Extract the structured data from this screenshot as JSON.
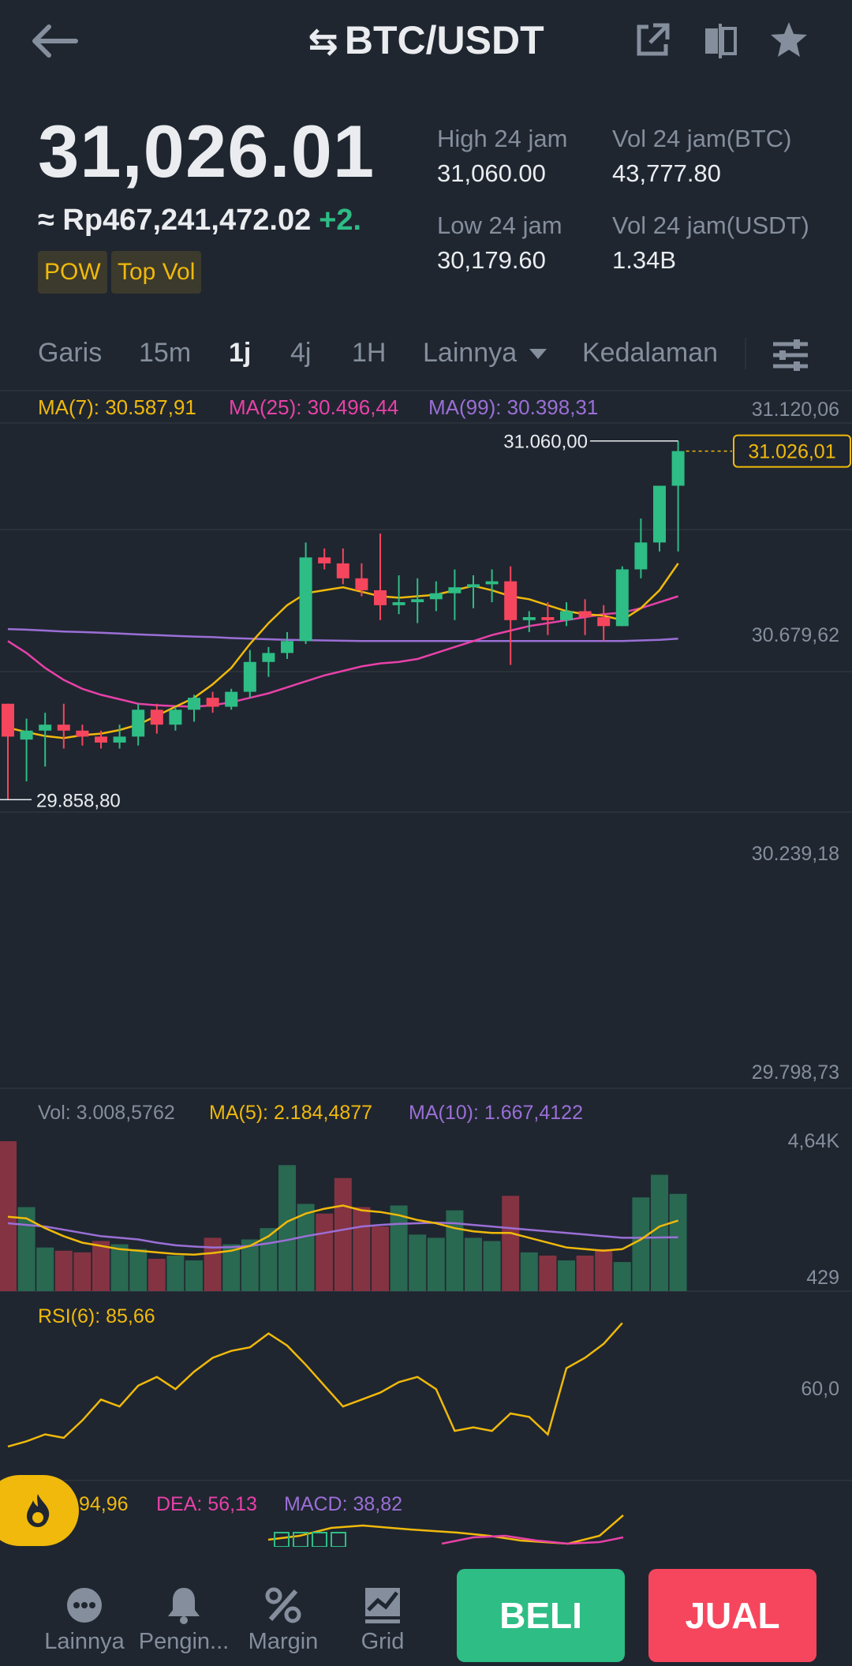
{
  "header": {
    "pair": "BTC/USDT",
    "swap_symbol": "⇆"
  },
  "price": {
    "last": "31,026.01",
    "fiat": "≈ Rp467,241,472.02",
    "change": "+2."
  },
  "tags": [
    "POW",
    "Top Vol"
  ],
  "stats": {
    "high_label": "High 24 jam",
    "high_value": "31,060.00",
    "low_label": "Low 24 jam",
    "low_value": "30,179.60",
    "vol_btc_label": "Vol 24 jam(BTC)",
    "vol_btc_value": "43,777.80",
    "vol_usdt_label": "Vol 24 jam(USDT)",
    "vol_usdt_value": "1.34B"
  },
  "timeframes": {
    "items": [
      "Garis",
      "15m",
      "1j",
      "4j",
      "1H",
      "Lainnya",
      "Kedalaman"
    ],
    "active": "1j"
  },
  "colors": {
    "up": "#2ebd85",
    "down": "#f6465d",
    "ma7": "#f0b90b",
    "ma25": "#e841a8",
    "ma99": "#9b6fd6",
    "accent": "#f0b90b"
  },
  "chart_data": [
    {
      "type": "candlestick",
      "title": "",
      "legend": {
        "ma7": "MA(7): 30.587,91",
        "ma25": "MA(25): 30.496,44",
        "ma99": "MA(99): 30.398,31"
      },
      "y_ticks": [
        "31.120,06",
        "30.679,62",
        "30.239,18",
        "29.798,73"
      ],
      "ylim": [
        29798.73,
        31120.06
      ],
      "max_label": "31.060,00",
      "min_label": "29.858,80",
      "last_price_label": "31.026,01",
      "candles": [
        [
          30180,
          30180,
          29860,
          30070
        ],
        [
          30060,
          30130,
          29920,
          30090
        ],
        [
          30090,
          30150,
          29970,
          30110
        ],
        [
          30110,
          30180,
          30030,
          30090
        ],
        [
          30090,
          30110,
          30040,
          30070
        ],
        [
          30070,
          30090,
          30030,
          30050
        ],
        [
          30050,
          30110,
          30030,
          30070
        ],
        [
          30070,
          30180,
          30040,
          30160
        ],
        [
          30160,
          30180,
          30080,
          30110
        ],
        [
          30110,
          30170,
          30090,
          30160
        ],
        [
          30160,
          30210,
          30120,
          30200
        ],
        [
          30200,
          30220,
          30150,
          30170
        ],
        [
          30170,
          30230,
          30160,
          30220
        ],
        [
          30220,
          30360,
          30200,
          30320
        ],
        [
          30320,
          30370,
          30270,
          30350
        ],
        [
          30350,
          30420,
          30330,
          30390
        ],
        [
          30390,
          30720,
          30380,
          30670
        ],
        [
          30670,
          30700,
          30630,
          30650
        ],
        [
          30650,
          30700,
          30580,
          30600
        ],
        [
          30600,
          30650,
          30540,
          30560
        ],
        [
          30560,
          30750,
          30460,
          30510
        ],
        [
          30510,
          30610,
          30480,
          30520
        ],
        [
          30520,
          30600,
          30450,
          30530
        ],
        [
          30530,
          30590,
          30490,
          30550
        ],
        [
          30550,
          30630,
          30460,
          30570
        ],
        [
          30570,
          30610,
          30500,
          30580
        ],
        [
          30580,
          30630,
          30520,
          30590
        ],
        [
          30590,
          30640,
          30310,
          30460
        ],
        [
          30460,
          30490,
          30420,
          30470
        ],
        [
          30470,
          30520,
          30410,
          30460
        ],
        [
          30460,
          30520,
          30440,
          30490
        ],
        [
          30490,
          30530,
          30410,
          30470
        ],
        [
          30470,
          30510,
          30390,
          30440
        ],
        [
          30440,
          30640,
          30440,
          30630
        ],
        [
          30630,
          30800,
          30600,
          30720
        ],
        [
          30720,
          30900,
          30690,
          30910
        ],
        [
          30910,
          31060,
          30690,
          31026
        ]
      ],
      "ma7": [
        30100,
        30085,
        30072,
        30065,
        30075,
        30080,
        30092,
        30110,
        30140,
        30170,
        30200,
        30245,
        30300,
        30380,
        30450,
        30510,
        30550,
        30560,
        30570,
        30555,
        30540,
        30535,
        30540,
        30545,
        30560,
        30575,
        30560,
        30540,
        30530,
        30510,
        30490,
        30480,
        30475,
        30460,
        30500,
        30560,
        30650
      ],
      "ma25": [
        30390,
        30350,
        30300,
        30260,
        30230,
        30210,
        30195,
        30180,
        30175,
        30172,
        30170,
        30175,
        30185,
        30200,
        30215,
        30235,
        30255,
        30275,
        30290,
        30305,
        30315,
        30320,
        30330,
        30350,
        30370,
        30390,
        30410,
        30425,
        30440,
        30450,
        30460,
        30470,
        30480,
        30485,
        30500,
        30520,
        30540
      ],
      "ma99": [
        30430,
        30428,
        30425,
        30422,
        30420,
        30418,
        30415,
        30412,
        30410,
        30407,
        30405,
        30403,
        30400,
        30398,
        30396,
        30394,
        30393,
        30392,
        30391,
        30390,
        30390,
        30390,
        30390,
        30390,
        30390,
        30390,
        30390,
        30390,
        30390,
        30390,
        30390,
        30390,
        30390,
        30390,
        30392,
        30394,
        30398
      ]
    },
    {
      "type": "bar",
      "title": "",
      "legend": {
        "vol": "Vol: 3.008,5762",
        "ma5": "MA(5): 2.184,4877",
        "ma10": "MA(10): 1.667,4122"
      },
      "y_ticks": [
        "4,64K",
        "429"
      ],
      "values": [
        4640,
        2600,
        1350,
        1250,
        1200,
        1550,
        1450,
        1300,
        1000,
        1100,
        950,
        1650,
        1450,
        1600,
        1950,
        3900,
        2700,
        2400,
        3500,
        2600,
        2000,
        2650,
        1750,
        1650,
        2500,
        1650,
        1550,
        2950,
        1200,
        1100,
        950,
        1100,
        1300,
        900,
        2900,
        3600,
        3010
      ],
      "ma5": [
        2300,
        2250,
        1950,
        1700,
        1500,
        1400,
        1300,
        1250,
        1200,
        1150,
        1130,
        1180,
        1250,
        1400,
        1700,
        2150,
        2400,
        2550,
        2650,
        2500,
        2450,
        2350,
        2200,
        2100,
        1950,
        1850,
        1800,
        1800,
        1650,
        1500,
        1350,
        1300,
        1250,
        1300,
        1600,
        2000,
        2184
      ],
      "ma10": [
        2100,
        2050,
        2000,
        1900,
        1800,
        1700,
        1650,
        1600,
        1500,
        1420,
        1380,
        1350,
        1360,
        1400,
        1480,
        1580,
        1700,
        1800,
        1900,
        2000,
        2050,
        2080,
        2100,
        2120,
        2100,
        2050,
        2000,
        1950,
        1900,
        1850,
        1800,
        1750,
        1700,
        1650,
        1650,
        1660,
        1667
      ]
    },
    {
      "type": "line",
      "title": "",
      "legend": {
        "rsi": "RSI(6): 85,66"
      },
      "y_ticks": [
        "60,0"
      ],
      "values": [
        15,
        18,
        22,
        20,
        30,
        42,
        38,
        50,
        55,
        48,
        58,
        66,
        70,
        72,
        80,
        73,
        62,
        50,
        38,
        42,
        46,
        52,
        55,
        48,
        24,
        26,
        24,
        34,
        32,
        22,
        60,
        66,
        74,
        86
      ]
    },
    {
      "type": "bar",
      "title": "",
      "legend": {
        "dif": "94,96",
        "dea": "DEA: 56,13",
        "macd": "MACD: 38,82"
      }
    }
  ],
  "nav": {
    "items": [
      "Lainnya",
      "Pengin...",
      "Margin",
      "Grid"
    ],
    "buy": "BELI",
    "sell": "JUAL"
  }
}
